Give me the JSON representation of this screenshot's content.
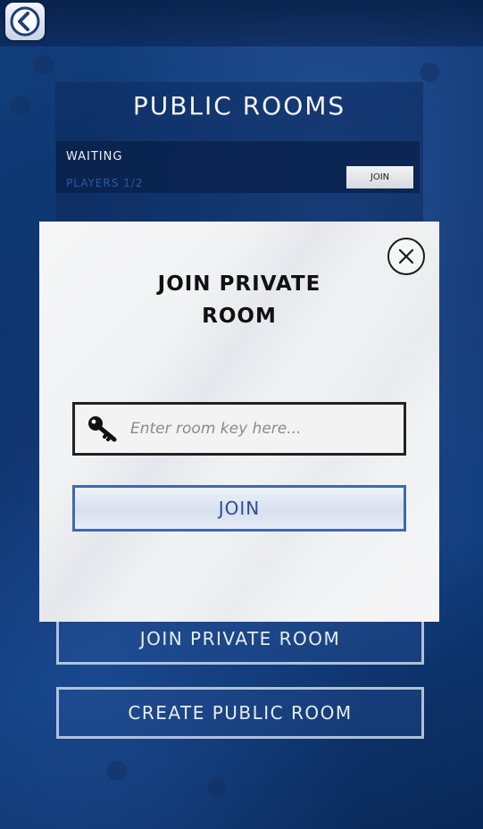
{
  "header": {
    "back_icon": "back-arrow-icon"
  },
  "public_rooms": {
    "title": "PUBLIC ROOMS",
    "rooms": [
      {
        "status": "WAITING",
        "players": "PLAYERS 1/2",
        "join_label": "JOIN"
      }
    ]
  },
  "buttons": {
    "join_private": "JOIN PRIVATE ROOM",
    "create_public": "CREATE PUBLIC ROOM"
  },
  "dialog": {
    "title_line1": "JOIN PRIVATE",
    "title_line2": "ROOM",
    "key_placeholder": "Enter room key here...",
    "key_value": "",
    "key_icon": "key-icon",
    "close_icon": "close-icon",
    "join_label": "JOIN"
  },
  "colors": {
    "background": "#0c2f66",
    "accent": "#3f68ad",
    "dialog_bg": "#f3f3f4"
  }
}
